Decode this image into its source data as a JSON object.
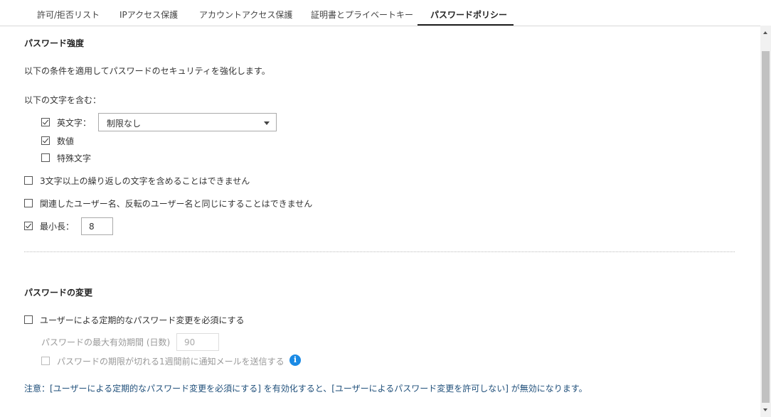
{
  "tabs": [
    "許可/拒否リスト",
    "IPアクセス保護",
    "アカウントアクセス保護",
    "証明書とプライベートキー",
    "パスワードポリシー"
  ],
  "strength": {
    "title": "パスワード強度",
    "description": "以下の条件を適用してパスワードのセキュリティを強化します。",
    "include_label": "以下の文字を含む：",
    "letters_label": "英文字：",
    "letters_select": "制限なし",
    "digits_label": "数値",
    "special_label": "特殊文字",
    "no_repeat_label": "3文字以上の繰り返しの文字を含めることはできません",
    "no_username_label": "関連したユーザー名、反転のユーザー名と同じにすることはできません",
    "min_length_label": "最小長：",
    "min_length_value": "8"
  },
  "change": {
    "title": "パスワードの変更",
    "require_periodic_label": "ユーザーによる定期的なパスワード変更を必須にする",
    "max_validity_label": "パスワードの最大有効期間 (日数)",
    "max_validity_value": "90",
    "notify_label": "パスワードの期限が切れる1週間前に通知メールを送信する",
    "note": "注意：[ユーザーによる定期的なパスワード変更を必須にする] を有効化すると、[ユーザーによるパスワード変更を許可しない] が無効になります。"
  },
  "icons": {
    "info": "info-icon",
    "dropdown": "chevron-down-icon"
  },
  "colors": {
    "info": "#1a8ae5",
    "note": "#1f4f7a"
  }
}
